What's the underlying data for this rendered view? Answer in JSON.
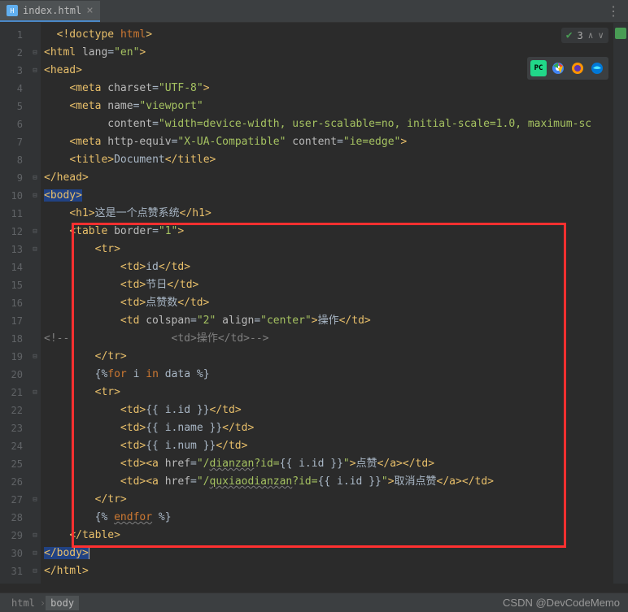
{
  "tab": {
    "label": "index.html"
  },
  "inspection": {
    "count": "3"
  },
  "gutter_lines": [
    "1",
    "2",
    "3",
    "4",
    "5",
    "6",
    "7",
    "8",
    "9",
    "10",
    "11",
    "12",
    "13",
    "14",
    "15",
    "16",
    "17",
    "18",
    "19",
    "20",
    "21",
    "22",
    "23",
    "24",
    "25",
    "26",
    "27",
    "28",
    "29",
    "30",
    "31"
  ],
  "code": {
    "l1": {
      "doctype": "<!doctype ",
      "html": "html",
      "close": ">"
    },
    "l2": {
      "o": "<html ",
      "attr": "lang",
      "eq": "=",
      "val": "\"en\"",
      "c": ">"
    },
    "l3": {
      "o": "<head>"
    },
    "l4": {
      "o": "<meta ",
      "a1": "charset",
      "eq": "=",
      "v1": "\"UTF-8\"",
      "c": ">"
    },
    "l5": {
      "o": "<meta ",
      "a1": "name",
      "eq": "=",
      "v1": "\"viewport\""
    },
    "l6": {
      "a1": "content",
      "eq": "=",
      "v1": "\"width=device-width, user-scalable=no, initial-scale=1.0, maximum-sc"
    },
    "l7": {
      "o": "<meta ",
      "a1": "http-equiv",
      "eq1": "=",
      "v1": "\"X-UA-Compatible\"",
      "sp": " ",
      "a2": "content",
      "eq2": "=",
      "v2": "\"ie=edge\"",
      "c": ">"
    },
    "l8": {
      "o": "<title>",
      "tx": "Document",
      "c": "</title>"
    },
    "l9": {
      "c": "</head>"
    },
    "l10": {
      "o": "<body>"
    },
    "l11": {
      "o": "<h1>",
      "tx": "这是一个点赞系统",
      "c": "</h1>"
    },
    "l12": {
      "o": "<table ",
      "a1": "border",
      "eq": "=",
      "v1": "\"1\"",
      "c": ">"
    },
    "l13": {
      "o": "<tr>"
    },
    "l14": {
      "o": "<td>",
      "tx": "id",
      "c": "</td>"
    },
    "l15": {
      "o": "<td>",
      "tx": "节日",
      "c": "</td>"
    },
    "l16": {
      "o": "<td>",
      "tx": "点赞数",
      "c": "</td>"
    },
    "l17": {
      "o": "<td ",
      "a1": "colspan",
      "eq1": "=",
      "v1": "\"2\"",
      "sp": " ",
      "a2": "align",
      "eq2": "=",
      "v2": "\"center\"",
      "c1": ">",
      "tx": "操作",
      "c2": "</td>"
    },
    "l18": {
      "cm1": "<!--                <td>",
      "cm2": "操作",
      "cm3": "</td>-->"
    },
    "l19": {
      "c": "</tr>"
    },
    "l20": {
      "o": "{%",
      "kw": "for",
      "sp1": " ",
      "var": "i ",
      "kw2": "in",
      "sp2": " ",
      "var2": "data ",
      "c": "%}"
    },
    "l21": {
      "o": "<tr>"
    },
    "l22": {
      "o": "<td>",
      "tx": "{{ i.id }}",
      "c": "</td>"
    },
    "l23": {
      "o": "<td>",
      "tx": "{{ i.name }}",
      "c": "</td>"
    },
    "l24": {
      "o": "<td>",
      "tx": "{{ i.num }}",
      "c": "</td>"
    },
    "l25": {
      "o": "<td><a ",
      "a1": "href",
      "eq": "=",
      "v1": "\"/",
      "url": "dianzan",
      "v2": "?id=",
      "ex": "{{ i.id }}",
      "v3": "\"",
      "c1": ">",
      "tx": "点赞",
      "c2": "</a></td>"
    },
    "l26": {
      "o": "<td><a ",
      "a1": "href",
      "eq": "=",
      "v1": "\"/",
      "url": "quxiaodianzan",
      "v2": "?id=",
      "ex": "{{ i.id }}",
      "v3": "\"",
      "c1": ">",
      "tx": "取消点赞",
      "c2": "</a></td>"
    },
    "l27": {
      "c": "</tr>"
    },
    "l28": {
      "o": "{% ",
      "kw": "endfor",
      "c": " %}"
    },
    "l29": {
      "c": "</table>"
    },
    "l30": {
      "c": "</body>"
    },
    "l31": {
      "c": "</html>"
    }
  },
  "breadcrumb": {
    "c1": "html",
    "c2": "body"
  },
  "watermark": "CSDN @DevCodeMemo"
}
